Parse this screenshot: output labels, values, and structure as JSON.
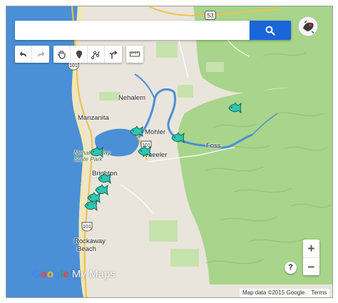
{
  "search": {
    "placeholder": "",
    "value": ""
  },
  "toolbar": {
    "undo_icon": "undo-icon",
    "redo_icon": "redo-icon",
    "pan_icon": "hand-icon",
    "marker_icon": "marker-icon",
    "line_icon": "draw-line-icon",
    "directions_icon": "directions-icon",
    "measure_icon": "ruler-icon"
  },
  "places": {
    "manzanita": "Manzanita",
    "nehalem": "Nehalem",
    "mohler": "Mohler",
    "wheeler": "Wheeler",
    "foss": "Foss",
    "park_line1": "Nehalem Bay",
    "park_line2": "State Park",
    "brighton": "Brighton",
    "rockaway_line1": "Rockaway",
    "rockaway_line2": "Beach"
  },
  "roads": {
    "hwy53": "53",
    "hwy101_north": "101",
    "hwy101_wheeler": "101",
    "hwy101_south": "101"
  },
  "markers": {
    "icon": "fish-icon",
    "count": 9,
    "color": "#2dc7b1"
  },
  "controls": {
    "zoom_in": "+",
    "zoom_out": "−",
    "help": "?"
  },
  "branding": {
    "google": "Google",
    "product": "My Maps"
  },
  "attribution": {
    "data": "Map data ©2015 Google",
    "terms": "Terms"
  },
  "colors": {
    "water": "#4b8fd6",
    "forest": "#a8d48b",
    "land": "#e9e5dc",
    "search_button": "#1a66d8",
    "highway": "#f1c14a"
  }
}
